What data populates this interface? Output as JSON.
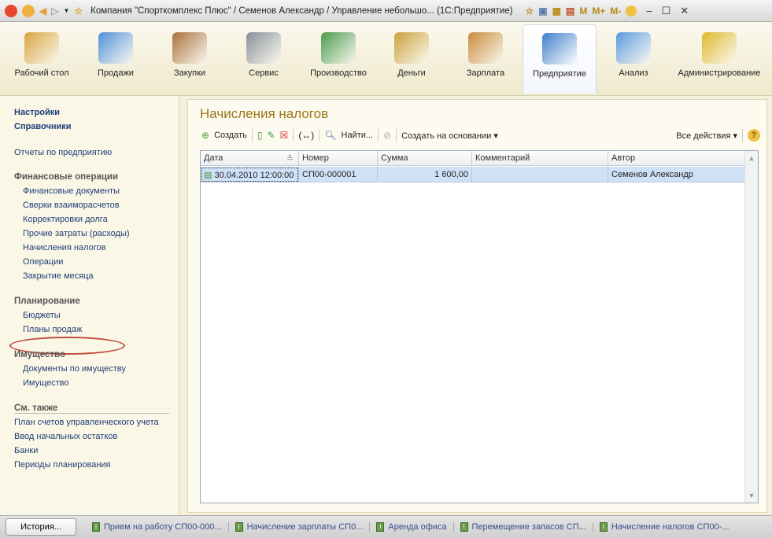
{
  "window": {
    "title": "Компания \"Спорткомплекс Плюс\" / Семенов Александр / Управление небольшо... (1С:Предприятие)",
    "tools": [
      "M",
      "M+",
      "M-"
    ]
  },
  "sections": [
    {
      "label": "Рабочий стол",
      "color": "#d9a441"
    },
    {
      "label": "Продажи",
      "color": "#4f8fd8"
    },
    {
      "label": "Закупки",
      "color": "#a9703a"
    },
    {
      "label": "Сервис",
      "color": "#8a8f98"
    },
    {
      "label": "Производство",
      "color": "#4c9a4c"
    },
    {
      "label": "Деньги",
      "color": "#c9a13a"
    },
    {
      "label": "Зарплата",
      "color": "#c98a3a"
    },
    {
      "label": "Предприятие",
      "color": "#3f7fc9"
    },
    {
      "label": "Анализ",
      "color": "#5a9adf"
    },
    {
      "label": "Администрирование",
      "color": "#e0b82c"
    }
  ],
  "sidebar": {
    "top": [
      "Настройки",
      "Справочники"
    ],
    "reports": "Отчеты по предприятию",
    "fin": {
      "title": "Финансовые операции",
      "items": [
        "Финансовые документы",
        "Сверки взаиморасчетов",
        "Корректировки долга",
        "Прочие затраты (расходы)",
        "Начисления налогов",
        "Операции",
        "Закрытие месяца"
      ]
    },
    "plan": {
      "title": "Планирование",
      "items": [
        "Бюджеты",
        "Планы продаж"
      ]
    },
    "prop": {
      "title": "Имущество",
      "items": [
        "Документы по имуществу",
        "Имущество"
      ]
    },
    "see": {
      "title": "См. также",
      "items": [
        "План счетов управленческого учета",
        "Ввод начальных остатков",
        "Банки",
        "Периоды планирования"
      ]
    }
  },
  "main": {
    "title": "Начисления налогов",
    "toolbar": {
      "create": "Создать",
      "find": "Найти...",
      "create_based": "Создать на основании",
      "all_actions": "Все действия"
    },
    "columns": [
      "Дата",
      "Номер",
      "Сумма",
      "Комментарий",
      "Автор"
    ],
    "rows": [
      {
        "date": "30.04.2010 12:00:00",
        "number": "СП00-000001",
        "sum": "1 600,00",
        "comment": "",
        "author": "Семенов Александр"
      }
    ]
  },
  "bottom": {
    "history": "История...",
    "items": [
      "Прием на работу СП00-000...",
      "Начисление зарплаты СП0...",
      "Аренда офиса",
      "Перемещение запасов СП...",
      "Начисление налогов СП00-..."
    ]
  }
}
